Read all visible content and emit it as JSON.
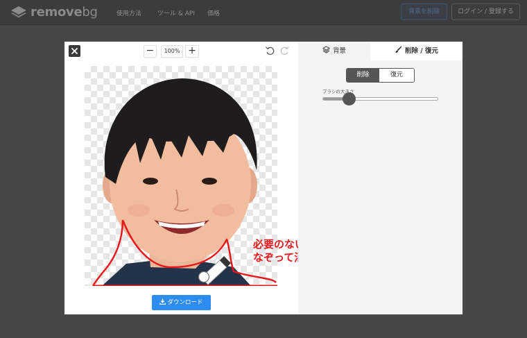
{
  "header": {
    "logo": {
      "icon": "layers-logo-icon",
      "text_bold": "remove",
      "text_light": "bg"
    },
    "nav": [
      "使用方法",
      "ツール & API",
      "価格"
    ],
    "remove_bg_button": "背景を削除",
    "login_button": "ログイン / 登録する"
  },
  "modal": {
    "close_icon": "close-icon",
    "zoom": {
      "minus": "−",
      "value": "100%",
      "plus": "+"
    },
    "undo_icon": "undo-icon",
    "redo_icon": "redo-icon",
    "annotation": {
      "line1": "必要のない部分を",
      "line2": "なぞって消していく",
      "color": "#e8191c"
    },
    "download_button": "ダウンロード",
    "download_icon": "download-icon"
  },
  "panel": {
    "tabs": [
      {
        "label": "背景",
        "icon": "layers-icon",
        "active": false
      },
      {
        "label": "削除 / 復元",
        "icon": "brush-icon",
        "active": true
      }
    ],
    "mode": {
      "erase": "削除",
      "restore": "復元",
      "selected": "削除"
    },
    "brush_size_label": "ブラシの大きさ",
    "brush_size_fraction": 0.23
  },
  "colors": {
    "accent": "#2d8cf0",
    "annotation": "#e8191c",
    "topbar": "#3c3c3c"
  }
}
